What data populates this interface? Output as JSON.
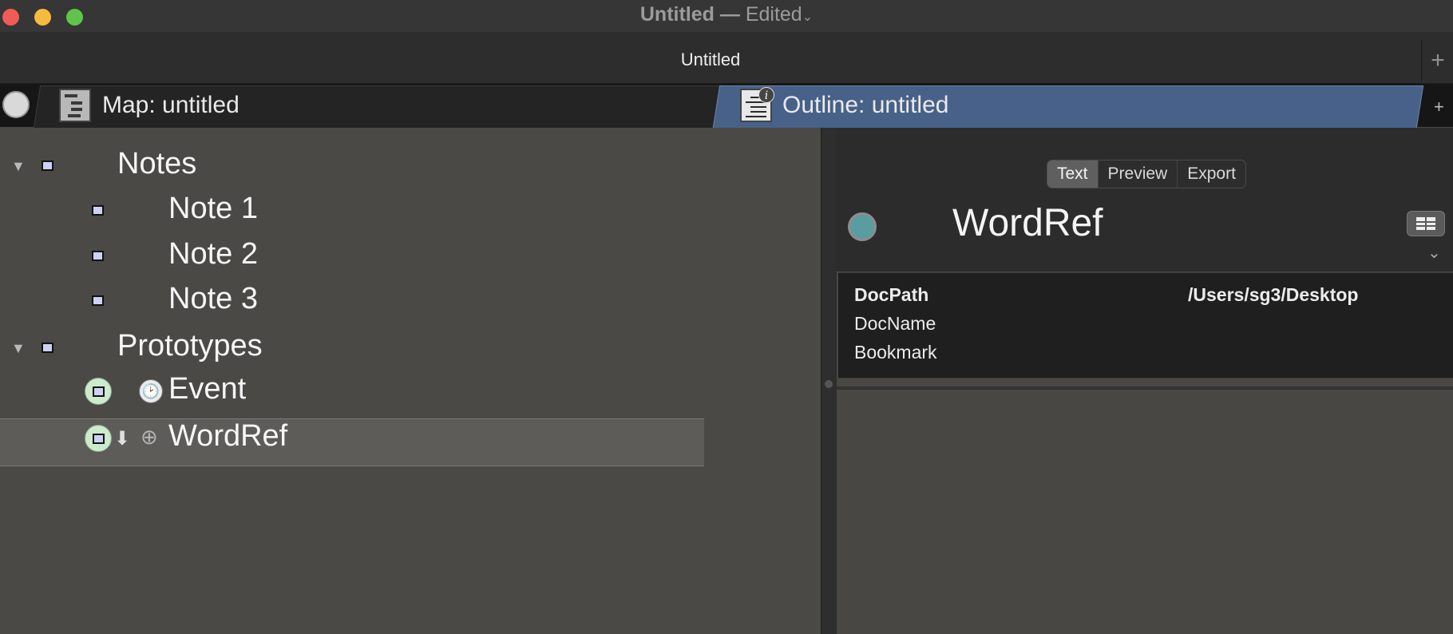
{
  "window": {
    "title": "Untitled",
    "separator": "—",
    "status": "Edited",
    "status_chevron": "⌄"
  },
  "doc_tabs": {
    "active_label": "Untitled",
    "add_label": "+"
  },
  "view_tabs": {
    "map_label": "Map: untitled",
    "outline_label": "Outline: untitled",
    "info_badge": "i",
    "add_label": "+"
  },
  "outline": {
    "items": [
      {
        "label": "Notes",
        "level": 0,
        "expanded": true
      },
      {
        "label": "Note 1",
        "level": 1
      },
      {
        "label": "Note 2",
        "level": 1
      },
      {
        "label": "Note 3",
        "level": 1
      },
      {
        "label": "Prototypes",
        "level": 0,
        "expanded": true
      },
      {
        "label": "Event",
        "level": 1,
        "icon": "clock-icon",
        "prototype": true
      },
      {
        "label": "WordRef",
        "level": 1,
        "icon": "add-icon",
        "prototype": true,
        "selected": true
      }
    ],
    "disclosure_glyph": "▼"
  },
  "text_pane": {
    "segments": [
      "Text",
      "Preview",
      "Export"
    ],
    "active_segment": "Text",
    "note_title": "WordRef",
    "attributes": [
      {
        "name": "DocPath",
        "value": "/Users/sg3/Desktop",
        "bold": true
      },
      {
        "name": "DocName",
        "value": ""
      },
      {
        "name": "Bookmark",
        "value": ""
      }
    ]
  },
  "colors": {
    "outline_tab_active": "#476189",
    "prototype_badge": "#cdeacc",
    "note_icon_fill": "#cdd2f4"
  }
}
